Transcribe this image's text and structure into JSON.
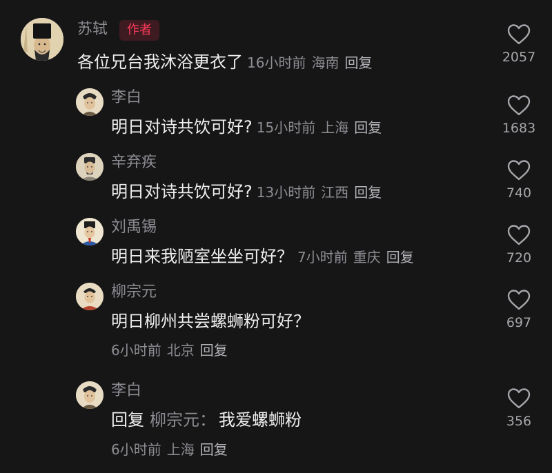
{
  "comments": [
    {
      "author": "苏轼",
      "badge": "作者",
      "text": "各位兄台我沐浴更衣了",
      "time": "16小时前",
      "location": "海南",
      "reply_label": "回复",
      "likes": "2057"
    },
    {
      "author": "李白",
      "text": "明日对诗共饮可好?",
      "time": "15小时前",
      "location": "上海",
      "reply_label": "回复",
      "likes": "1683"
    },
    {
      "author": "辛弃疾",
      "text": "明日对诗共饮可好?",
      "time": "13小时前",
      "location": "江西",
      "reply_label": "回复",
      "likes": "740"
    },
    {
      "author": "刘禹锡",
      "text": "明日来我陋室坐坐可好？",
      "time": "7小时前",
      "location": "重庆",
      "reply_label": "回复",
      "likes": "720"
    },
    {
      "author": "柳宗元",
      "text": "明日柳州共尝螺蛳粉可好？",
      "time": "6小时前",
      "location": "北京",
      "reply_label": "回复",
      "likes": "697"
    },
    {
      "author": "李白",
      "reply_prefix": "回复",
      "reply_to": "柳宗元：",
      "text": "我爱螺蛳粉",
      "time": "6小时前",
      "location": "上海",
      "reply_label": "回复",
      "likes": "356"
    }
  ],
  "icons": {
    "like": "heart-outline-icon"
  },
  "colors": {
    "background": "#161617",
    "badge_text": "#ff3b5c",
    "badge_bg": "#3e1b21"
  }
}
